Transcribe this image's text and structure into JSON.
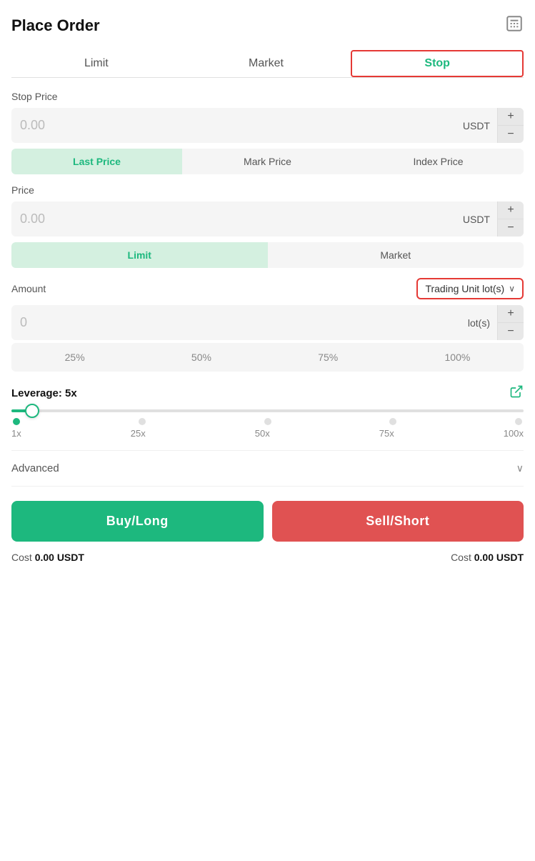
{
  "header": {
    "title": "Place Order",
    "calculator_icon": "calculator"
  },
  "tabs": [
    {
      "id": "limit",
      "label": "Limit",
      "active": false
    },
    {
      "id": "market",
      "label": "Market",
      "active": false
    },
    {
      "id": "stop",
      "label": "Stop",
      "active": true
    }
  ],
  "stop_price": {
    "label": "Stop Price",
    "value": "0.00",
    "unit": "USDT",
    "plus": "+",
    "minus": "−"
  },
  "trigger_type": {
    "options": [
      {
        "id": "last_price",
        "label": "Last Price",
        "active": true
      },
      {
        "id": "mark_price",
        "label": "Mark Price",
        "active": false
      },
      {
        "id": "index_price",
        "label": "Index Price",
        "active": false
      }
    ]
  },
  "price": {
    "label": "Price",
    "value": "0.00",
    "unit": "USDT",
    "plus": "+",
    "minus": "−"
  },
  "order_type": {
    "options": [
      {
        "id": "limit",
        "label": "Limit",
        "active": true
      },
      {
        "id": "market",
        "label": "Market",
        "active": false
      }
    ]
  },
  "amount": {
    "label": "Amount",
    "dropdown_label": "Trading Unit lot(s)",
    "value": "0",
    "unit": "lot(s)",
    "plus": "+",
    "minus": "−",
    "percentages": [
      "25%",
      "50%",
      "75%",
      "100%"
    ]
  },
  "leverage": {
    "label": "Leverage: 5x",
    "slider_labels": [
      "1x",
      "25x",
      "50x",
      "75x",
      "100x"
    ],
    "current": 5,
    "min": 1,
    "max": 100
  },
  "advanced": {
    "label": "Advanced",
    "chevron": "∨"
  },
  "buttons": {
    "buy": "Buy/Long",
    "sell": "Sell/Short"
  },
  "cost": {
    "buy_label": "Cost",
    "buy_value": "0.00 USDT",
    "sell_label": "Cost",
    "sell_value": "0.00 USDT"
  }
}
